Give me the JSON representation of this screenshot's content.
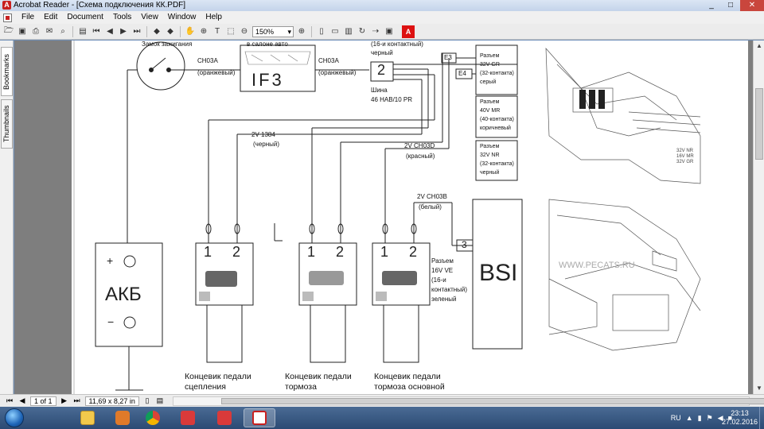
{
  "window": {
    "app_icon": "acrobat-icon",
    "title": "Acrobat Reader - [Схема подключения КК.PDF]",
    "buttons": [
      "_",
      "□",
      "✕"
    ]
  },
  "menu": [
    "File",
    "Edit",
    "Document",
    "Tools",
    "View",
    "Window",
    "Help"
  ],
  "toolbar": {
    "zoom_value": "150%",
    "text_tool": "T",
    "adobe_label": "A"
  },
  "sidebar": {
    "tabs": [
      "Bookmarks",
      "Thumbnails"
    ]
  },
  "status": {
    "page_indicator": "1 of 1",
    "page_size": "11,69 x 8,27 in"
  },
  "diagram": {
    "ignition_label": "Замок зажигания",
    "fuse_box_label": "в салоне авто",
    "wire_ch03a_left": "CH03A",
    "wire_ch03a_left_color": "(оранжевый)",
    "wire_ch03a_right": "CH03A",
    "wire_ch03a_right_color": "(оранжевый)",
    "fuse_id": "IF3",
    "connector_16_top": "(16-и контактный)",
    "connector_16_color": "черный",
    "junction_number": "2",
    "bus_label": "Шина",
    "bus_id": "46 HAB/10 PR",
    "e3_label": "E3",
    "e4_label": "E4",
    "conn1_title": "Разъем",
    "conn1_id": "32V GR",
    "conn1_pins": "(32-контакта)",
    "conn1_color": "серый",
    "conn2_title": "Разъем",
    "conn2_id": "40V MR",
    "conn2_pins": "(40-контакта)",
    "conn2_color": "коричневый",
    "conn3_title": "Разъем",
    "conn3_id": "32V NR",
    "conn3_pins": "(32-контакта)",
    "conn3_color": "черный",
    "wire_1384": "2V 1384",
    "wire_1384_color": "(черный)",
    "wire_ch03d": "2V CH03D",
    "wire_ch03d_color": "(красный)",
    "wire_ch03b": "2V CH03B",
    "wire_ch03b_color": "(белый)",
    "battery_label": "АКБ",
    "battery_plus": "+",
    "battery_minus": "−",
    "pin1": "1",
    "pin2": "2",
    "bsi_label": "BSI",
    "bsi_pin": "3",
    "bsi_conn_title": "Разъем",
    "bsi_conn_id": "16V VE",
    "bsi_conn_pins": "(16-и",
    "bsi_conn_pins2": "контактный)",
    "bsi_conn_color": "зеленый",
    "switch1_line1": "Концевик педали",
    "switch1_line2": "сцепления",
    "switch2_line1": "Концевик педали",
    "switch2_line2": "тормоза",
    "switch3_line1": "Концевик педали",
    "switch3_line2": "тормоза основной",
    "watermark": "WWW.PECATS.RU",
    "engine_labels": [
      "32V NR",
      "16V MR",
      "32V GR"
    ]
  },
  "taskbar": {
    "language": "RU",
    "time": "23:13",
    "date": "27.02.2016"
  }
}
